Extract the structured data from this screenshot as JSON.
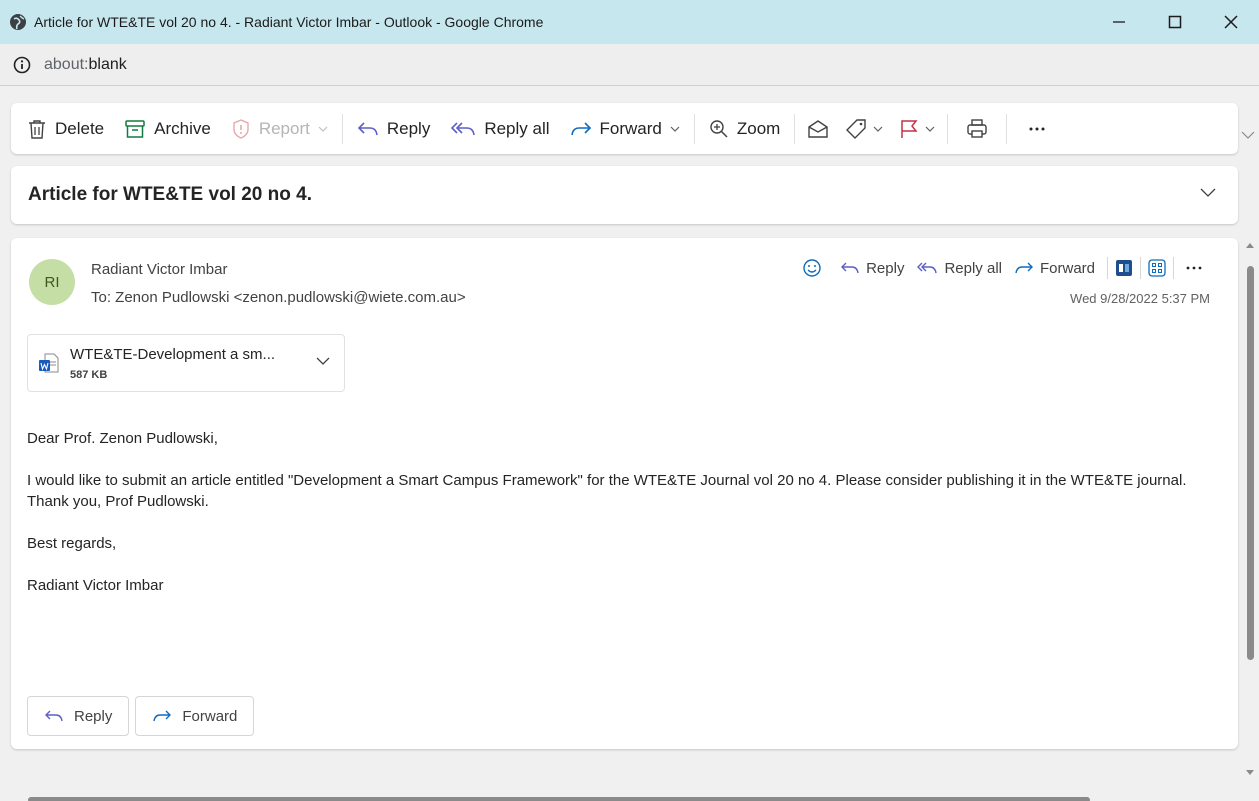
{
  "window": {
    "title": "Article for WTE&TE vol 20 no 4. - Radiant Victor Imbar - Outlook - Google Chrome",
    "address_scheme": "about:",
    "address_path": "blank"
  },
  "toolbar": {
    "delete": "Delete",
    "archive": "Archive",
    "report": "Report",
    "reply": "Reply",
    "reply_all": "Reply all",
    "forward": "Forward",
    "zoom": "Zoom"
  },
  "subject": "Article for WTE&TE vol 20 no 4.",
  "message": {
    "avatar_initials": "RI",
    "sender": "Radiant Victor Imbar",
    "to": "To: Zenon Pudlowski <zenon.pudlowski@wiete.com.au>",
    "date": "Wed 9/28/2022 5:37 PM",
    "actions": {
      "reply": "Reply",
      "reply_all": "Reply all",
      "forward": "Forward"
    },
    "attachment": {
      "name": "WTE&TE-Development a sm...",
      "size": "587 KB"
    },
    "body": {
      "greeting": "Dear Prof. Zenon Pudlowski,",
      "paragraph": "I would like to submit an article entitled \"Development a Smart Campus Framework\" for the WTE&TE Journal vol 20 no 4. Please consider publishing it in the WTE&TE journal. Thank you, Prof Pudlowski.",
      "closing": "Best regards,",
      "signature": "Radiant Victor Imbar"
    },
    "footer": {
      "reply": "Reply",
      "forward": "Forward"
    }
  },
  "colors": {
    "titlebar_bg": "#c7e7ee",
    "avatar_bg": "#c5dea6",
    "accent_blue": "#0f6cbd",
    "flag_red": "#c4314b"
  }
}
